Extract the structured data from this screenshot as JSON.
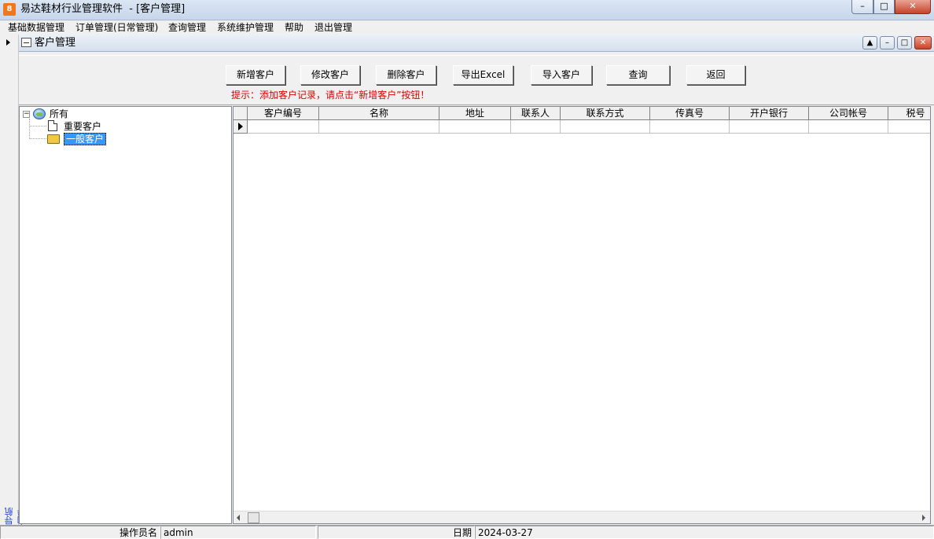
{
  "window": {
    "title": "易达鞋材行业管理软件  - [客户管理]",
    "app_icon_glyph": "8",
    "minimize": "–",
    "maximize": "□",
    "close": "✕"
  },
  "menu": [
    "基础数据管理",
    "订单管理(日常管理)",
    "查询管理",
    "系统维护管理",
    "帮助",
    "退出管理"
  ],
  "nav": {
    "guide_label": "导航向导"
  },
  "child_window": {
    "title": "客户管理"
  },
  "toolbar": {
    "buttons": [
      "新增客户",
      "修改客户",
      "删除客户",
      "导出Excel",
      "导入客户",
      "查询",
      "返回"
    ],
    "hint": "提示：添加客户记录，请点击“新增客户”按钮！"
  },
  "tree": {
    "root": "所有",
    "children": [
      "重要客户",
      "一般客户"
    ],
    "selected": "一般客户"
  },
  "grid": {
    "columns": [
      "客户编号",
      "名称",
      "地址",
      "联系人",
      "联系方式",
      "传真号",
      "开户银行",
      "公司帐号",
      "税号"
    ]
  },
  "status": {
    "operator_label": "操作员名",
    "operator_value": "admin",
    "date_label": "日期",
    "date_value": "2024-03-27"
  }
}
